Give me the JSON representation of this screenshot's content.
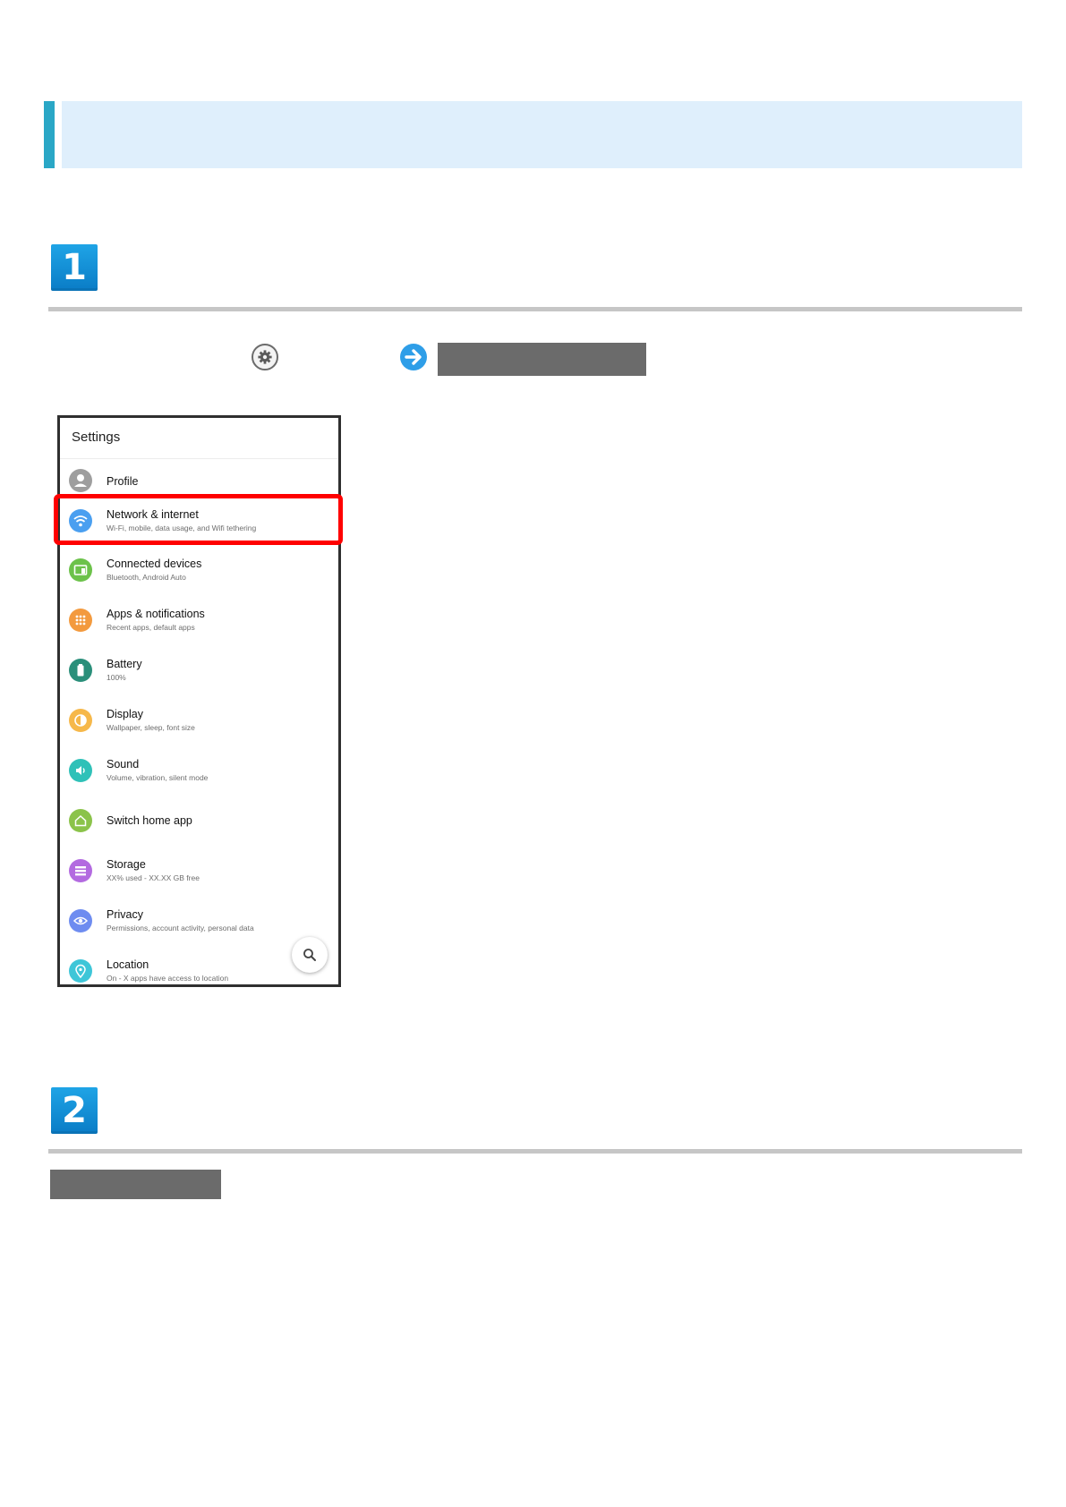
{
  "steps": [
    {
      "number": "1"
    },
    {
      "number": "2"
    }
  ],
  "instruction_icons": {
    "settings": "gear-icon",
    "next": "arrow-right-circle-icon"
  },
  "settings_screen": {
    "title": "Settings",
    "items": [
      {
        "label": "Profile",
        "sub": "",
        "icon": "person-icon",
        "color": "#9e9e9e"
      },
      {
        "label": "Network & internet",
        "sub": "Wi-Fi, mobile, data usage, and Wifi tethering",
        "icon": "wifi-icon",
        "color": "#4a9ff0"
      },
      {
        "label": "Connected devices",
        "sub": "Bluetooth, Android Auto",
        "icon": "devices-icon",
        "color": "#6cc24a"
      },
      {
        "label": "Apps & notifications",
        "sub": "Recent apps, default apps",
        "icon": "apps-grid-icon",
        "color": "#f39a3e"
      },
      {
        "label": "Battery",
        "sub": "100%",
        "icon": "battery-icon",
        "color": "#2a8f7a"
      },
      {
        "label": "Display",
        "sub": "Wallpaper, sleep, font size",
        "icon": "brightness-icon",
        "color": "#f6b84a"
      },
      {
        "label": "Sound",
        "sub": "Volume, vibration, silent mode",
        "icon": "speaker-icon",
        "color": "#2fc1b8"
      },
      {
        "label": "Switch home app",
        "sub": "",
        "icon": "home-icon",
        "color": "#8bc34a"
      },
      {
        "label": "Storage",
        "sub": "XX% used - XX.XX GB free",
        "icon": "storage-icon",
        "color": "#b36ae0"
      },
      {
        "label": "Privacy",
        "sub": "Permissions, account activity, personal data",
        "icon": "eye-icon",
        "color": "#6e8cf0"
      },
      {
        "label": "Location",
        "sub": "On - X apps have access to location",
        "icon": "location-pin-icon",
        "color": "#3ec6d8"
      }
    ],
    "highlighted_item": "Network & internet",
    "fab_icon": "search-icon"
  },
  "colors": {
    "banner_accent": "#2aa7c6",
    "banner_body": "#dfeffc",
    "step_badge": "#0a8ad6",
    "highlight": "#ff0000",
    "redaction": "#6b6b6b"
  }
}
